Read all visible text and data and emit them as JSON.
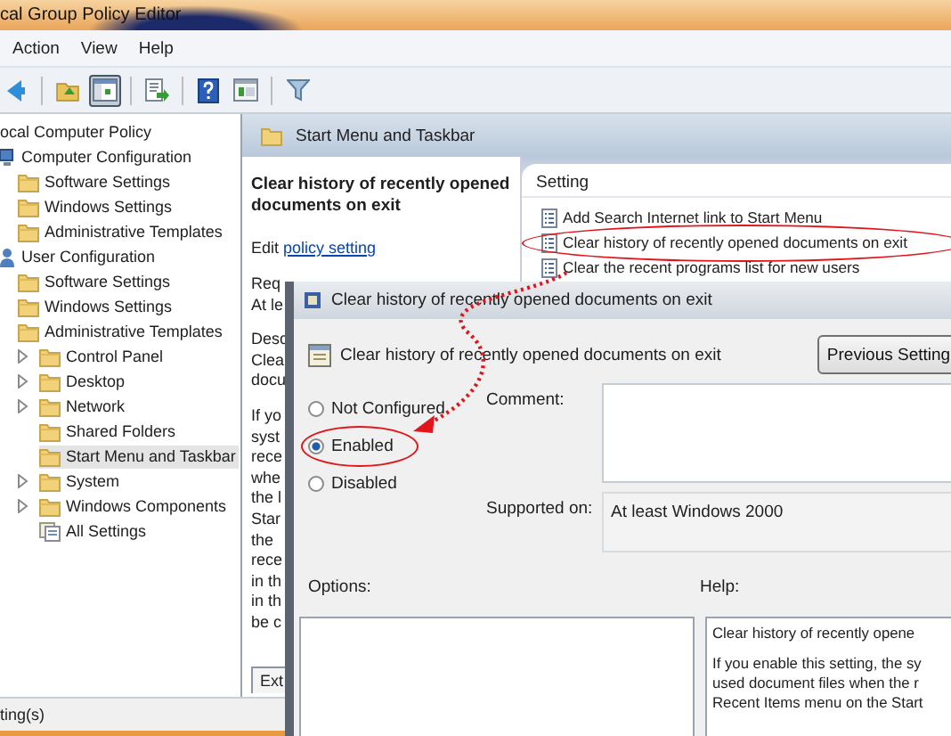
{
  "window": {
    "title": "cal Group Policy Editor"
  },
  "menu": [
    "Action",
    "View",
    "Help"
  ],
  "toolbar": [
    {
      "kind": "back",
      "pressed": false
    },
    {
      "kind": "separator"
    },
    {
      "kind": "up",
      "pressed": false
    },
    {
      "kind": "tree",
      "pressed": true
    },
    {
      "kind": "separator"
    },
    {
      "kind": "export",
      "pressed": false
    },
    {
      "kind": "separator"
    },
    {
      "kind": "help",
      "pressed": false
    },
    {
      "kind": "view",
      "pressed": false
    },
    {
      "kind": "separator"
    },
    {
      "kind": "filter",
      "pressed": false
    }
  ],
  "tree": [
    {
      "label": "ocal Computer Policy",
      "selected": false,
      "children": [
        {
          "label": "Computer Configuration",
          "kind": "computer",
          "selected": false,
          "children": [
            {
              "label": "Software Settings",
              "kind": "folder",
              "selected": false
            },
            {
              "label": "Windows Settings",
              "kind": "folder",
              "selected": false
            },
            {
              "label": "Administrative Templates",
              "kind": "folder",
              "selected": false
            }
          ]
        },
        {
          "label": "User Configuration",
          "kind": "user",
          "selected": false,
          "children": [
            {
              "label": "Software Settings",
              "kind": "folder",
              "selected": false
            },
            {
              "label": "Windows Settings",
              "kind": "folder",
              "selected": false
            },
            {
              "label": "Administrative Templates",
              "kind": "folder",
              "selected": false,
              "children": [
                {
                  "label": "Control Panel",
                  "kind": "folder",
                  "expanded": false,
                  "selected": false
                },
                {
                  "label": "Desktop",
                  "kind": "folder",
                  "expanded": false,
                  "selected": false
                },
                {
                  "label": "Network",
                  "kind": "folder",
                  "expanded": false,
                  "selected": false
                },
                {
                  "label": "Shared Folders",
                  "kind": "folder",
                  "selected": false
                },
                {
                  "label": "Start Menu and Taskbar",
                  "kind": "folder",
                  "selected": true
                },
                {
                  "label": "System",
                  "kind": "folder",
                  "expanded": false,
                  "selected": false
                },
                {
                  "label": "Windows Components",
                  "kind": "folder",
                  "expanded": false,
                  "selected": false
                },
                {
                  "label": "All Settings",
                  "kind": "settings",
                  "selected": false
                }
              ]
            }
          ]
        }
      ]
    }
  ],
  "pane": {
    "title": "Start Menu and Taskbar",
    "policy_title": "Clear history of recently opened documents on exit",
    "edit_prefix": "Edit",
    "edit_link": "policy setting",
    "fragments": [
      [
        "Req",
        "At le"
      ],
      [
        "Desc",
        "Clea",
        "docu"
      ],
      [
        "If yo",
        "syst",
        "rece",
        "whe",
        "the l",
        "Star",
        "the",
        "rece",
        "in th",
        "in th",
        "be c"
      ]
    ],
    "tab": "Ext"
  },
  "settings_list": {
    "column": "Setting",
    "items": [
      {
        "label": "Add Search Internet link to Start Menu",
        "circled": false
      },
      {
        "label": "Clear history of recently opened documents on exit",
        "circled": true
      },
      {
        "label": "Clear the recent programs list for new users",
        "circled": false
      }
    ]
  },
  "status_bar": "ting(s)",
  "dialog": {
    "title": "Clear history of recently opened documents on exit",
    "heading": "Clear history of recently opened documents on exit",
    "prev_button": "Previous Setting",
    "states": [
      {
        "label": "Not Configured",
        "selected": false,
        "circled": false
      },
      {
        "label": "Enabled",
        "selected": true,
        "circled": true
      },
      {
        "label": "Disabled",
        "selected": false,
        "circled": false
      }
    ],
    "comment_label": "Comment:",
    "supported_label": "Supported on:",
    "supported_value": "At least Windows 2000",
    "options_label": "Options:",
    "help_label": "Help:",
    "help_lines": [
      [
        "Clear history of recently opene"
      ],
      [
        "If you enable this setting, the sy",
        "used document files when the r",
        "Recent Items menu on the Start"
      ]
    ]
  }
}
